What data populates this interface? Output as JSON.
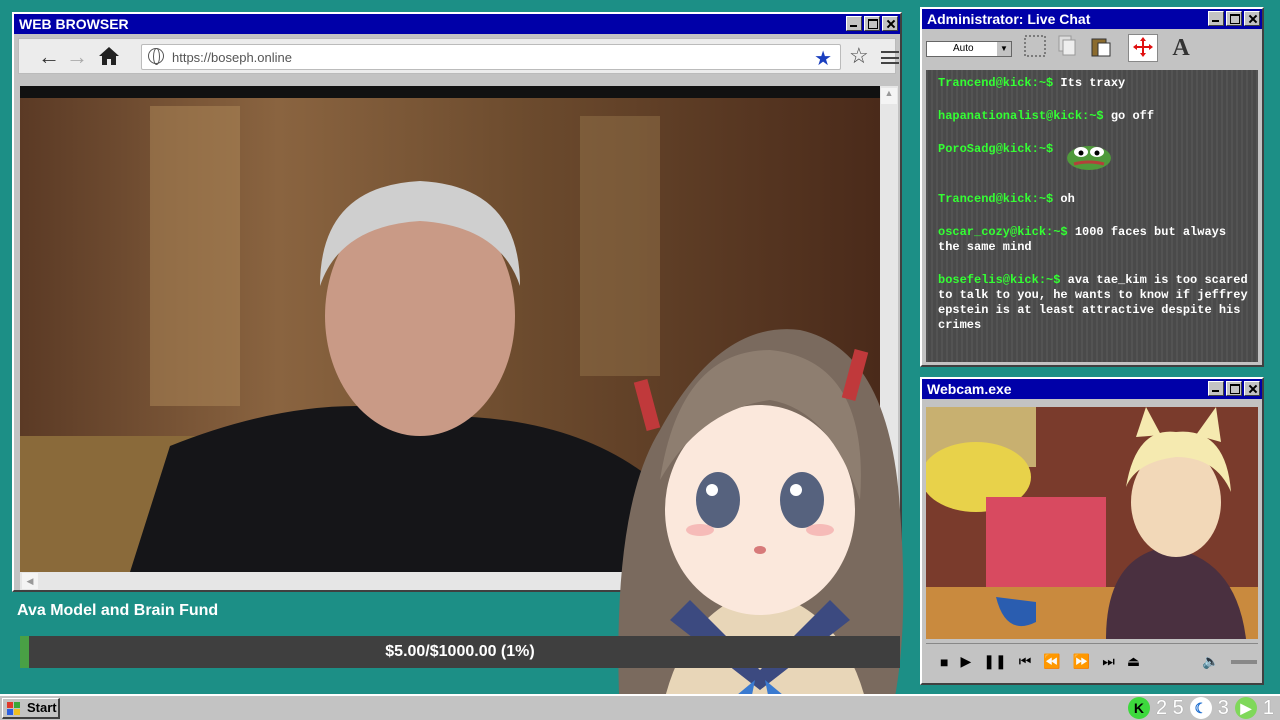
{
  "browser": {
    "title": "WEB BROWSER",
    "url": "https://boseph.online"
  },
  "chat": {
    "title": "Administrator: Live Chat",
    "zoom_select": "Auto",
    "messages": [
      {
        "user": "Trancend@kick:~$",
        "text": "Its traxy"
      },
      {
        "user": "hapanationalist@kick:~$",
        "text": "go off"
      },
      {
        "user": "PoroSadg@kick:~$",
        "text": ""
      },
      {
        "user": "Trancend@kick:~$",
        "text": "oh"
      },
      {
        "user": "oscar_cozy@kick:~$",
        "text": "1000 faces but always the same mind"
      },
      {
        "user": "bosefelis@kick:~$",
        "text": "ava tae_kim is too scared to talk to you, he wants to know if jeffrey epstein is at least attractive despite his crimes"
      }
    ],
    "emote": "pepe-emote"
  },
  "webcam": {
    "title": "Webcam.exe"
  },
  "fund": {
    "title": "Ava Model and Brain Fund",
    "label": "$5.00/$1000.00 (1%)",
    "progress_fraction": 0.01
  },
  "taskbar": {
    "start_label": "Start",
    "kick_count": "2 5",
    "moon_count": "3",
    "play_count": "1"
  },
  "colors": {
    "desktop": "#1c8f86",
    "titlebar": "#0000a8",
    "chat_username": "#33ff33",
    "fund_fill": "#49a045"
  }
}
